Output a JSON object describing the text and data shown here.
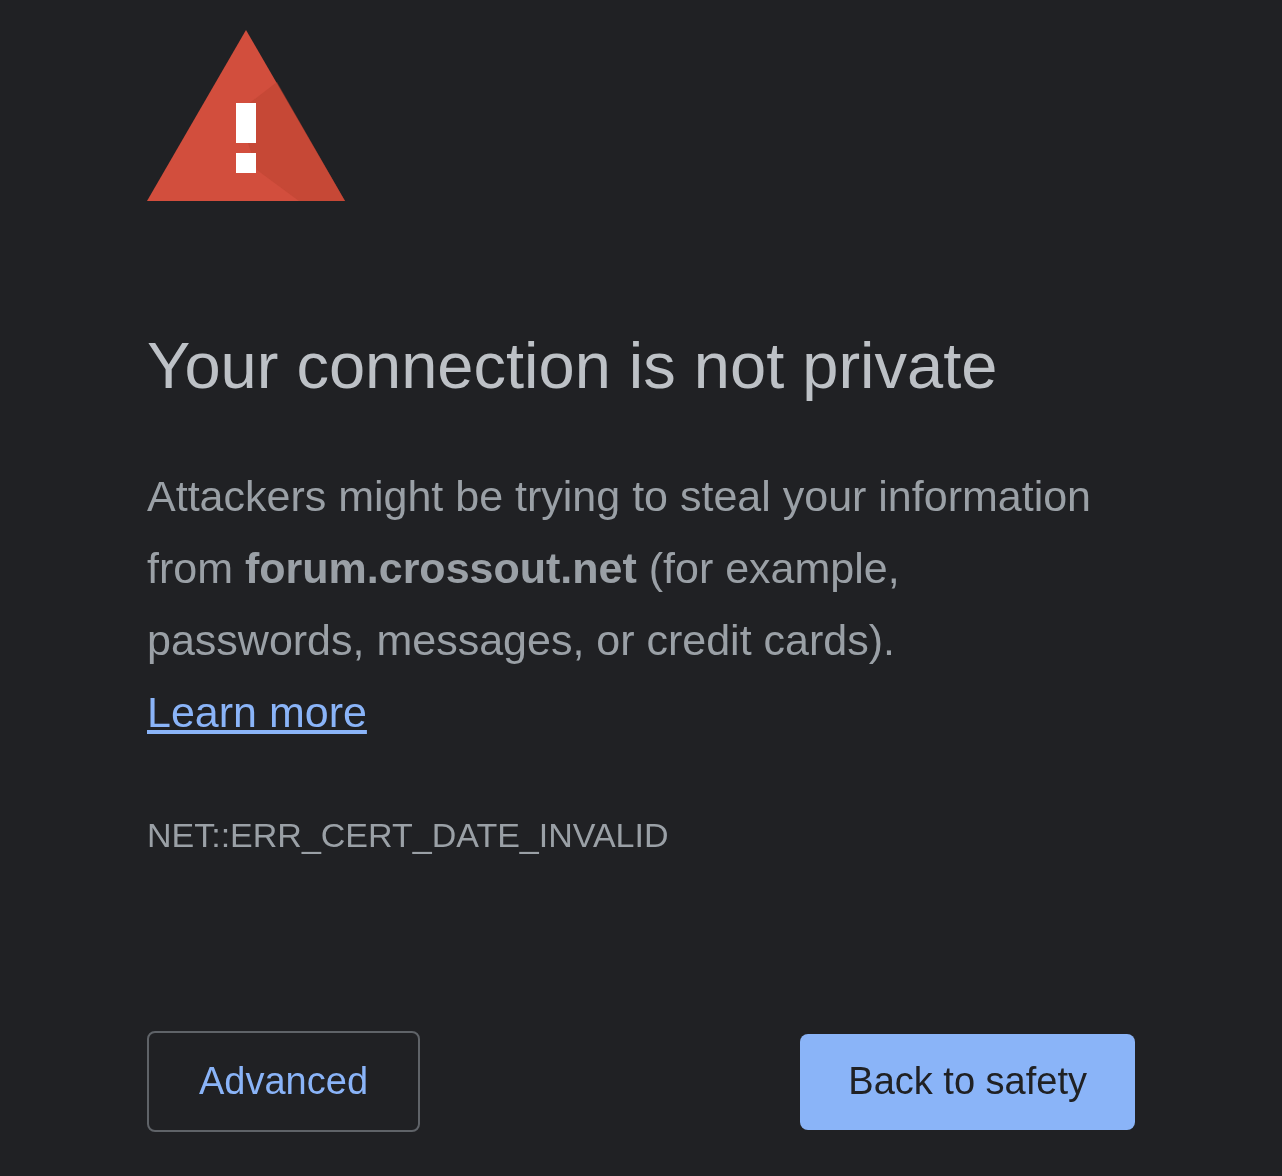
{
  "title": "Your connection is not private",
  "description": {
    "text": "Attackers might be trying to steal your information from **forum.crossout.net** (for example, passwords, messages, or credit cards).",
    "link": "Learn more"
  },
  "error_code": "NET::ERR_CERT_DATE_INVALID",
  "buttons": [
    {
      "label": "Advanced",
      "kind": "secondary"
    },
    {
      "label": "Back to safety",
      "kind": "primary"
    }
  ]
}
